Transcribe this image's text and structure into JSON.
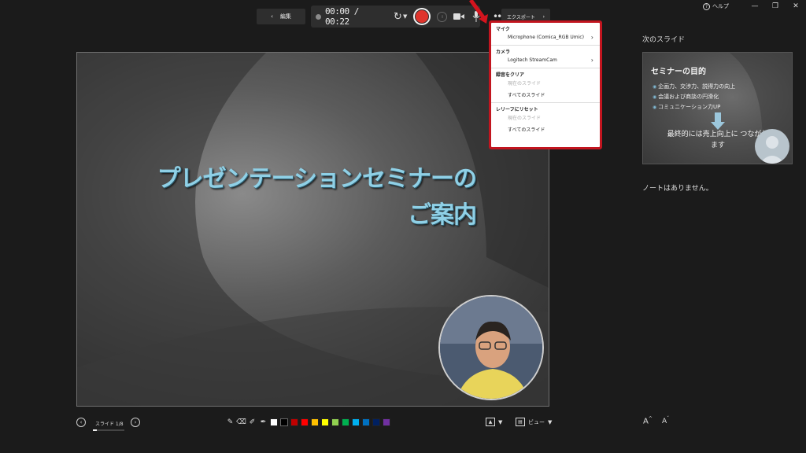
{
  "window": {
    "help_label": "ヘルプ"
  },
  "toolbar": {
    "edit_label": "編集",
    "timer": "00:00 / 00:22",
    "export_label": "エクスポート",
    "more_label": "•••"
  },
  "menu": {
    "sections": [
      {
        "header": "マイク",
        "items": [
          {
            "label": "Microphone (Comica_RGB Umic)",
            "disabled": false,
            "chevron": true
          }
        ]
      },
      {
        "header": "カメラ",
        "items": [
          {
            "label": "Logitech StreamCam",
            "disabled": false,
            "chevron": true
          }
        ]
      },
      {
        "header": "録音をクリア",
        "items": [
          {
            "label": "現在のスライド",
            "disabled": true,
            "chevron": false
          },
          {
            "label": "すべてのスライド",
            "disabled": false,
            "chevron": false
          }
        ]
      },
      {
        "header": "レリーフにリセット",
        "items": [
          {
            "label": "現在のスライド",
            "disabled": true,
            "chevron": false
          },
          {
            "label": "すべてのスライド",
            "disabled": false,
            "chevron": false
          }
        ]
      }
    ]
  },
  "slide": {
    "title_line1": "プレゼンテーションセミナーの",
    "title_line2": "ご案内"
  },
  "next_slide": {
    "label": "次のスライド",
    "title": "セミナーの目的",
    "bullets": [
      "企画力、交渉力、説得力の向上",
      "会議および商談の円滑化",
      "コミュニケーション力UP"
    ],
    "conclusion": "最終的には売上向上に つながります"
  },
  "notes": {
    "text": "ノートはありません。"
  },
  "bottom": {
    "slide_counter": "スライド 1/8",
    "slide_progress": 0.125,
    "view_label": "ビュー",
    "font_larger": "A",
    "font_smaller": "A",
    "colors": [
      "#ffffff",
      "#000000",
      "#c00000",
      "#ff0000",
      "#ffc000",
      "#ffff00",
      "#92d050",
      "#00b050",
      "#00b0f0",
      "#0070c0",
      "#002060",
      "#7030a0"
    ]
  }
}
